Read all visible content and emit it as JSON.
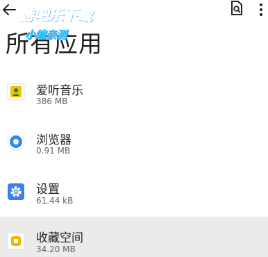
{
  "header": {
    "title": "所有应用",
    "back_icon": "back-arrow-icon",
    "search_icon": "search-doc-icon",
    "more_icon": "more-vert-icon"
  },
  "watermark": {
    "line1": "游吧乐下载",
    "line2": "小编亲测"
  },
  "apps": [
    {
      "name": "爱听音乐",
      "size": "386 MB",
      "icon": "music-app-icon"
    },
    {
      "name": "浏览器",
      "size": "0.91 MB",
      "icon": "browser-icon"
    },
    {
      "name": "设置",
      "size": "61.44 kB",
      "icon": "settings-gear-icon"
    },
    {
      "name": "收藏空间",
      "size": "34.20 MB",
      "icon": "favorites-space-icon"
    }
  ],
  "colors": {
    "background": "#ffffff",
    "highlight_row": "#ebebeb",
    "text_primary": "#1f1f1f",
    "text_secondary": "#5f6368",
    "watermark": "#18b9ff",
    "settings_icon": "#3d7ee8",
    "browser_icon": "#2d8cf0",
    "music_icon": "#f2c400",
    "favorites_icon": "#f5b800"
  }
}
